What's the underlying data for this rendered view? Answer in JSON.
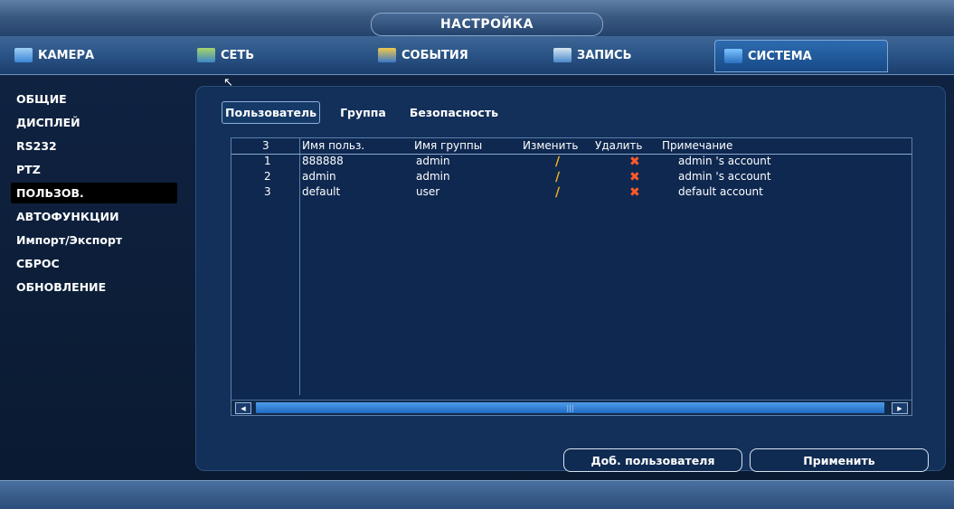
{
  "window": {
    "title": "НАСТРОЙКА"
  },
  "tabs": [
    {
      "label": "КАМЕРА",
      "icon": "camera-icon"
    },
    {
      "label": "СЕТЬ",
      "icon": "network-icon"
    },
    {
      "label": "СОБЫТИЯ",
      "icon": "events-icon"
    },
    {
      "label": "ЗАПИСЬ",
      "icon": "record-icon"
    },
    {
      "label": "СИСТЕМА",
      "icon": "system-icon",
      "active": true
    }
  ],
  "sidebar": {
    "items": [
      {
        "label": "ОБЩИЕ"
      },
      {
        "label": "ДИСПЛЕЙ"
      },
      {
        "label": "RS232"
      },
      {
        "label": "PTZ"
      },
      {
        "label": "ПОЛЬЗОВ.",
        "active": true
      },
      {
        "label": "АВТОФУНКЦИИ"
      },
      {
        "label": "Импорт/Экспорт"
      },
      {
        "label": "СБРОС"
      },
      {
        "label": "ОБНОВЛЕНИЕ"
      }
    ]
  },
  "subtabs": [
    {
      "label": "Пользователь",
      "active": true
    },
    {
      "label": "Группа"
    },
    {
      "label": "Безопасность"
    }
  ],
  "table": {
    "headers": {
      "count": "3",
      "username": "Имя польз.",
      "group": "Имя группы",
      "modify": "Изменить",
      "delete": "Удалить",
      "note": "Примечание"
    },
    "rows": [
      {
        "num": "1",
        "username": "888888",
        "group": "admin",
        "note": "admin 's account"
      },
      {
        "num": "2",
        "username": "admin",
        "group": "admin",
        "note": "admin 's account"
      },
      {
        "num": "3",
        "username": "default",
        "group": "user",
        "note": "default account"
      }
    ]
  },
  "buttons": {
    "add_user": "Доб. пользователя",
    "apply": "Применить"
  },
  "colors": {
    "background": "#0c1c33",
    "panel": "#12305a",
    "accent": "#1f6bc4",
    "edit_icon": "#f0b020",
    "delete_icon": "#ff5a2a"
  }
}
